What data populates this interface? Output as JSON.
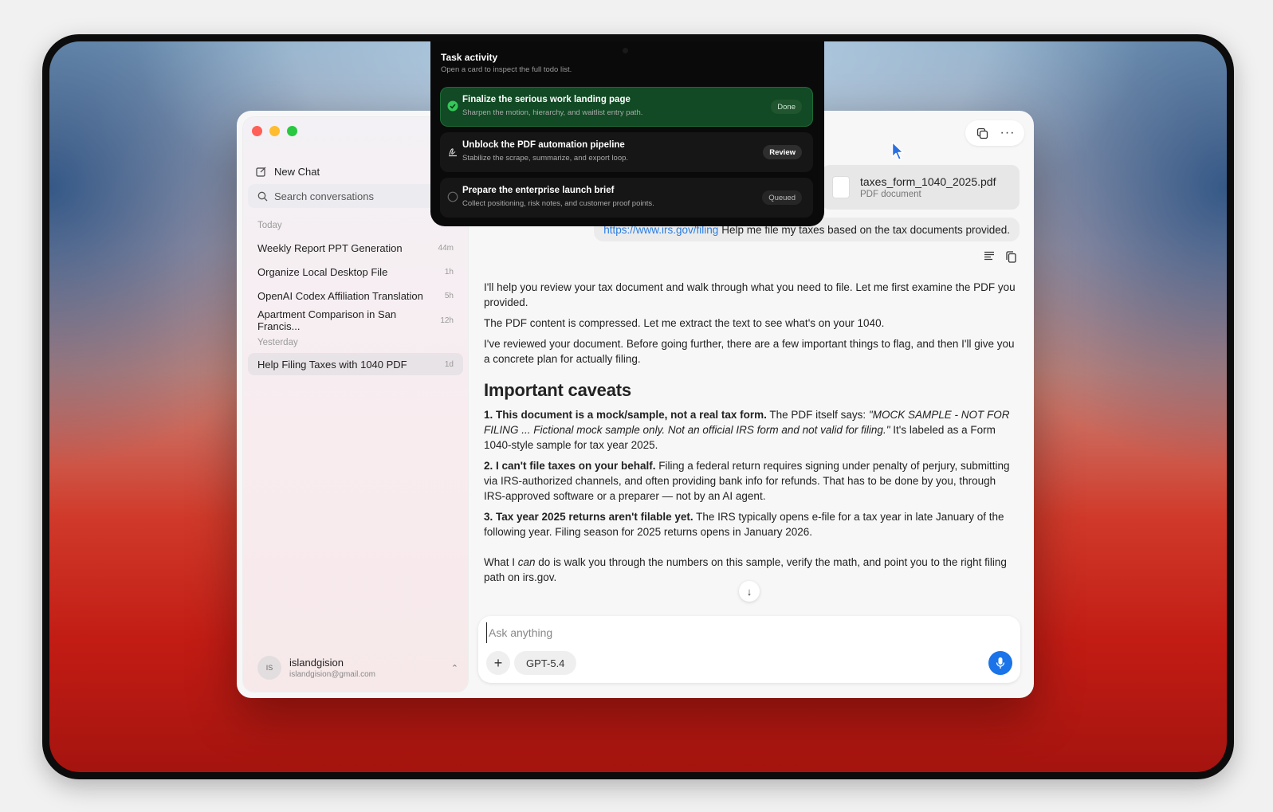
{
  "sidebar": {
    "new_chat": "New Chat",
    "search_placeholder": "Search conversations",
    "sections": [
      {
        "label": "Today",
        "items": [
          {
            "title": "Weekly Report PPT Generation",
            "time": "44m"
          },
          {
            "title": "Organize Local Desktop File",
            "time": "1h"
          },
          {
            "title": "OpenAI Codex Affiliation Translation",
            "time": "5h"
          },
          {
            "title": "Apartment Comparison in San Francis...",
            "time": "12h"
          }
        ]
      },
      {
        "label": "Yesterday",
        "items": [
          {
            "title": "Help Filing Taxes with 1040 PDF",
            "time": "1d"
          }
        ]
      }
    ],
    "user": {
      "initials": "IS",
      "name": "islandgision",
      "email": "islandgision@gmail.com"
    }
  },
  "task_activity": {
    "title": "Task activity",
    "subtitle": "Open a card to inspect the full todo list.",
    "tasks": [
      {
        "title": "Finalize the serious work landing page",
        "desc": "Sharpen the motion, hierarchy, and waitlist entry path.",
        "status": "Done"
      },
      {
        "title": "Unblock the PDF automation pipeline",
        "desc": "Stabilize the scrape, summarize, and export loop.",
        "status": "Review"
      },
      {
        "title": "Prepare the enterprise launch brief",
        "desc": "Collect positioning, risk notes, and customer proof points.",
        "status": "Queued"
      }
    ]
  },
  "chat": {
    "attachment": {
      "name": "taxes_form_1040_2025.pdf",
      "type": "PDF document"
    },
    "user_message": {
      "link": "https://www.irs.gov/filing",
      "text": "Help me file my taxes based on the tax documents provided."
    },
    "answer": {
      "p1": "I'll help you review your tax document and walk through what you need to file. Let me first examine the PDF you provided.",
      "p2": "The PDF content is compressed. Let me extract the text to see what's on your 1040.",
      "p3": "I've reviewed your document. Before going further, there are a few important things to flag, and then I'll give you a concrete plan for actually filing.",
      "heading": "Important caveats",
      "c1_bold": "1. This document is a mock/sample, not a real tax form.",
      "c1_text": " The PDF itself says: ",
      "c1_quote": "\"MOCK SAMPLE - NOT FOR FILING ... Fictional mock sample only. Not an official IRS form and not valid for filing.\"",
      "c1_tail": " It's labeled as a Form 1040-style sample for tax year 2025.",
      "c2_bold": "2. I can't file taxes on your behalf.",
      "c2_text": " Filing a federal return requires signing under penalty of perjury, submitting via IRS-authorized channels, and often providing bank info for refunds. That has to be done by you, through IRS-approved software or a preparer — not by an AI agent.",
      "c3_bold": "3. Tax year 2025 returns aren't filable yet.",
      "c3_text": " The IRS typically opens e-file for a tax year in late January of the following year. Filing season for 2025 returns opens in January 2026.",
      "p4_a": "What I ",
      "p4_em": "can",
      "p4_b": " do is walk you through the numbers on this sample, verify the math, and point you to the right filing path on irs.gov."
    }
  },
  "composer": {
    "placeholder": "Ask anything",
    "model": "GPT-5.4"
  },
  "colors": {
    "accent": "#1a73e8",
    "done_green": "#114a24",
    "link": "#2b7de0"
  }
}
